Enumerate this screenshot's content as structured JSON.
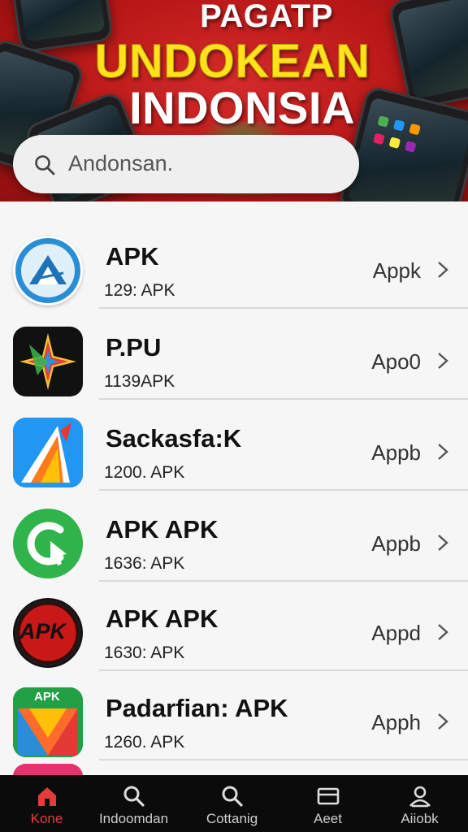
{
  "banner": {
    "line1": "PAGATP",
    "line2": "UNDOKEAN",
    "line3": "INDONSIA"
  },
  "search": {
    "placeholder": "Andonsan.",
    "icon": "search-icon"
  },
  "apps": [
    {
      "name": "APK",
      "size": "129: APK",
      "tag": "Appk",
      "icon": "mountain-emblem-icon"
    },
    {
      "name": "P.PU",
      "size": "1139APK",
      "tag": "Apo0",
      "icon": "colorful-star-icon"
    },
    {
      "name": "Sackasfa:K",
      "size": "1200. APK",
      "tag": "Appb",
      "icon": "flame-shape-icon"
    },
    {
      "name": "APK APK",
      "size": "1636: APK",
      "tag": "Appb",
      "icon": "green-arrow-circle-icon"
    },
    {
      "name": "APK APK",
      "size": "1630: APK",
      "tag": "Appd",
      "icon": "red-apk-badge-icon"
    },
    {
      "name": "Padarfian: APK",
      "size": "1260. APK",
      "tag": "Apph",
      "icon": "play-triangle-icon"
    }
  ],
  "badge_texts": {
    "apk_badge": "APK",
    "apk_top": "APK"
  },
  "nav": {
    "items": [
      {
        "label": "Kone",
        "icon": "home-icon",
        "active": true
      },
      {
        "label": "Indoomdan",
        "icon": "search-icon",
        "active": false
      },
      {
        "label": "Cottanig",
        "icon": "search-icon",
        "active": false
      },
      {
        "label": "Aeet",
        "icon": "inbox-icon",
        "active": false
      },
      {
        "label": "Aiiobk",
        "icon": "profile-icon",
        "active": false
      }
    ]
  },
  "colors": {
    "banner_red": "#c21f1f",
    "headline_yellow": "#ffe21a",
    "active_nav": "#e53b3b",
    "nav_bg": "#0b0b0b"
  }
}
